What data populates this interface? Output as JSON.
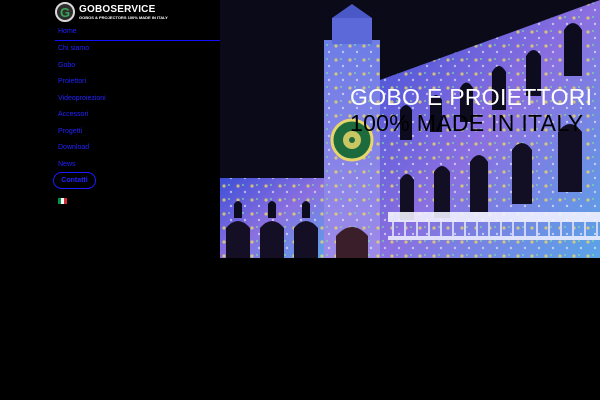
{
  "brand": {
    "name": "GOBOSERVICE",
    "tagline": "GOBOS & PROJECTORS 100% MADE IN ITALY",
    "logo_letter": "G",
    "icon": "gobo-logo-icon"
  },
  "nav": {
    "items": [
      {
        "label": "Home"
      },
      {
        "label": "Chi siamo"
      },
      {
        "label": "Gobo"
      },
      {
        "label": "Proiettori"
      },
      {
        "label": "Videoproiezioni"
      },
      {
        "label": "Accessori"
      },
      {
        "label": "Progetti"
      },
      {
        "label": "Download"
      },
      {
        "label": "News"
      }
    ],
    "contact_label": "Contatti",
    "language_icon": "italian-flag-icon"
  },
  "hero": {
    "title_line1": "GOBO E PROIETTORI",
    "title_line2": "100% MADE IN ITALY",
    "image": "illuminated-palazzo-facade-projection"
  },
  "colors": {
    "background": "#000000",
    "nav_text": "#2222ff",
    "accent_line": "#1111ff",
    "logo_green": "#3aa655",
    "flag": [
      "#009246",
      "#ffffff",
      "#ce2b37"
    ]
  }
}
